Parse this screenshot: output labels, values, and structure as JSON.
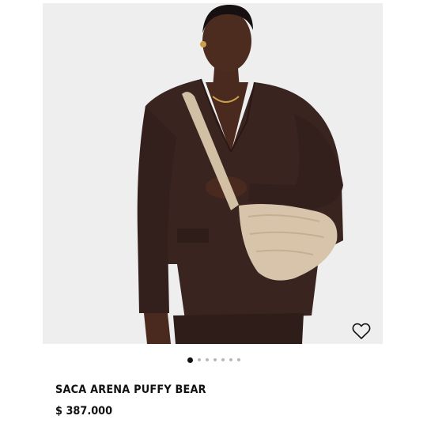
{
  "product": {
    "title": "SACA ARENA PUFFY BEAR",
    "price": "$ 387.000",
    "image_description_icon": "product-photo"
  },
  "carousel": {
    "total_slides": 7,
    "active_index": 0
  },
  "wishlist": {
    "icon": "heart-outline-icon"
  },
  "colors": {
    "background": "#ffffff",
    "image_background": "#eeeeee",
    "text": "#111111",
    "dot_active": "#111111",
    "dot_inactive": "#b8b8b8",
    "jacket": "#3a2420",
    "bag": "#d7c4aa"
  }
}
